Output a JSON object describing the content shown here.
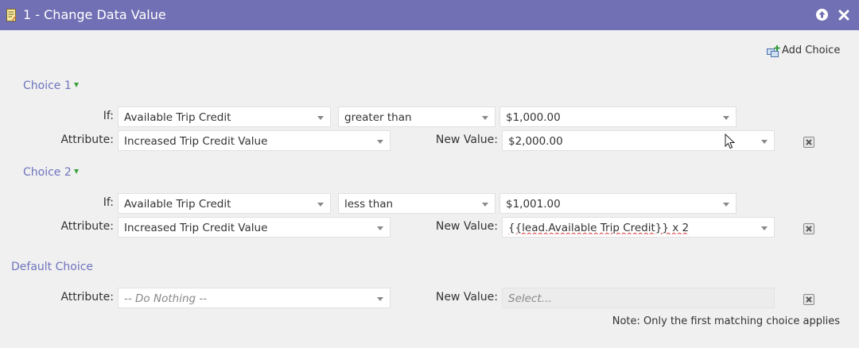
{
  "window": {
    "title": "1 - Change Data Value",
    "title_icon": "edit-document-icon",
    "buttons": [
      "collapse-up-icon",
      "close-icon"
    ]
  },
  "add_choice_label": "Add Choice",
  "labels": {
    "if": "If:",
    "attribute": "Attribute:",
    "new_value": "New Value:"
  },
  "choices": [
    {
      "title": "Choice 1",
      "if_field": "Available Trip Credit",
      "operator": "greater than",
      "compare_value": "$1,000.00",
      "attribute": "Increased Trip Credit Value",
      "new_value": "$2,000.00"
    },
    {
      "title": "Choice 2",
      "if_field": "Available Trip Credit",
      "operator": "less than",
      "compare_value": "$1,001.00",
      "attribute": "Increased Trip Credit Value",
      "new_value": "{{lead.Available Trip Credit}} x 2"
    }
  ],
  "default_choice": {
    "title": "Default Choice",
    "attribute": "-- Do Nothing --",
    "new_value_placeholder": "Select..."
  },
  "note": "Note: Only the first matching choice applies",
  "colors": {
    "titlebar": "#7270b4",
    "background": "#f0f0f0",
    "choice_header": "#6e74bd",
    "dropdown_triangle": "#3aa33a"
  }
}
